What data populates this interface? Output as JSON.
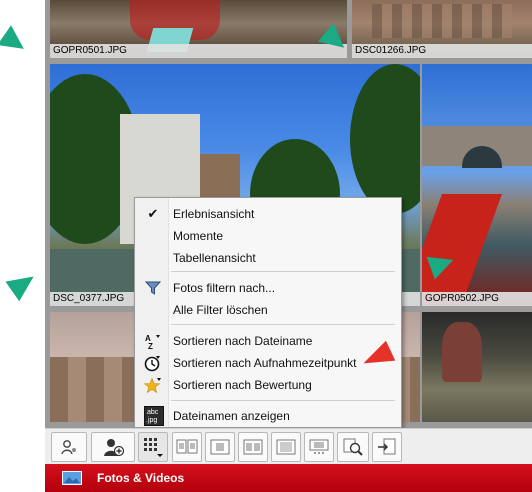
{
  "photos": {
    "top_left": {
      "filename": "GOPR0501.JPG"
    },
    "top_right": {
      "filename": "DSC01266.JPG"
    },
    "mid_left": {
      "filename": "DSC_0377.JPG"
    },
    "mid_right": {
      "filename": "GOPR0502.JPG"
    }
  },
  "context_menu": {
    "items": [
      {
        "label": "Erlebnisansicht",
        "checked": true
      },
      {
        "label": "Momente"
      },
      {
        "label": "Tabellenansicht"
      },
      {
        "label": "Fotos filtern nach...",
        "icon": "filter-icon"
      },
      {
        "label": "Alle Filter löschen"
      },
      {
        "label": "Sortieren nach Dateiname",
        "icon": "sort-az-icon"
      },
      {
        "label": "Sortieren nach Aufnahmezeitpunkt",
        "icon": "clock-icon"
      },
      {
        "label": "Sortieren nach Bewertung",
        "icon": "star-icon"
      },
      {
        "label": "Dateinamen anzeigen",
        "icon": "abc-jpg-icon"
      }
    ],
    "icon_text": {
      "abc": "abc",
      "jpg": ".jpg",
      "az_a": "A",
      "az_z": "Z"
    }
  },
  "bottom_bar": {
    "title": "Fotos & Videos"
  },
  "colors": {
    "accent_green": "#1aab84",
    "accent_red": "#e5332a",
    "bar_red": "#c8101a"
  }
}
